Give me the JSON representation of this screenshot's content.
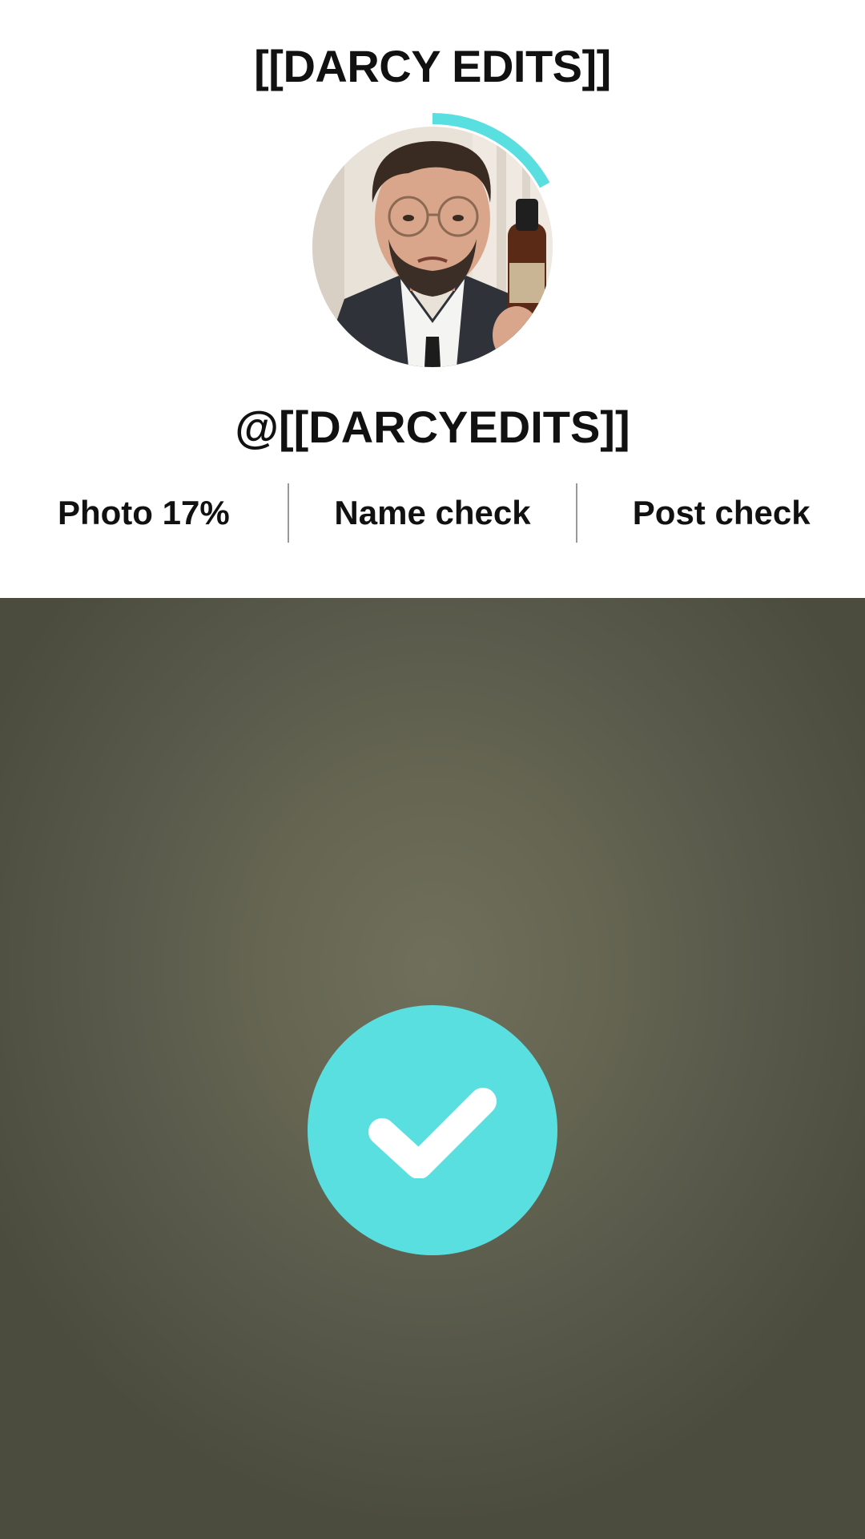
{
  "header": {
    "title": "[[DARCY EDITS]]",
    "handle": "@[[DARCYEDITS]]"
  },
  "avatar": {
    "progress_percent": 17,
    "ring_color": "#5adfe1"
  },
  "tabs": [
    {
      "label": "Photo 17%"
    },
    {
      "label": "Name check"
    },
    {
      "label": "Post check"
    }
  ],
  "check_button": {
    "icon": "checkmark-icon",
    "color": "#5adfe1"
  },
  "colors": {
    "accent": "#5adfe1",
    "text": "#111111",
    "header_bg": "#ffffff",
    "video_bg": "#626250"
  }
}
